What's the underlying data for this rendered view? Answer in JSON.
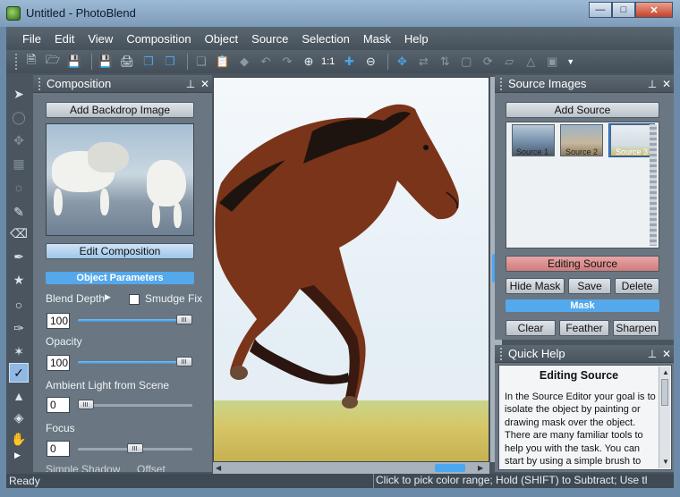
{
  "window": {
    "title": "Untitled - PhotoBlend",
    "minimize": "▭",
    "maximize": "□",
    "close": "✕"
  },
  "menu": [
    "File",
    "Edit",
    "View",
    "Composition",
    "Object",
    "Source",
    "Selection",
    "Mask",
    "Help"
  ],
  "toolbar": {
    "zoom_label": "1:1"
  },
  "composition_panel": {
    "title": "Composition",
    "add_backdrop_label": "Add Backdrop Image",
    "edit_composition_label": "Edit Composition",
    "object_parameters_label": "Object Parameters",
    "blend_depth_label": "Blend Depth",
    "smudge_fix_label": "Smudge Fix",
    "blend_depth_value": "100",
    "opacity_label": "Opacity",
    "opacity_value": "100",
    "ambient_light_label": "Ambient Light from Scene",
    "ambient_light_value": "0",
    "focus_label": "Focus",
    "focus_value": "0",
    "simple_shadow_label": "Simple Shadow",
    "offset_label": "Offset",
    "slider_levels": {
      "blend_depth": 1.0,
      "opacity": 1.0,
      "ambient_light": 0.0,
      "focus": 0.5
    }
  },
  "source_panel": {
    "title": "Source Images",
    "add_source_label": "Add Source",
    "sources": [
      "Source 1",
      "Source 2",
      "Source 3"
    ],
    "selected_source": "Source 3",
    "editing_source_label": "Editing Source",
    "hide_mask_label": "Hide Mask",
    "save_label": "Save",
    "delete_label": "Delete",
    "mask_label": "Mask",
    "clear_label": "Clear",
    "feather_label": "Feather",
    "sharpen_label": "Sharpen"
  },
  "quick_help": {
    "title": "Quick Help",
    "heading": "Editing Source",
    "body": "In the Source Editor your goal is to isolate the object by painting or drawing mask over the object. There are many familiar tools to help you with the task. You can start by using a simple brush to paint the mask or draw a mask"
  },
  "status": {
    "left": "Ready",
    "right": "Click to pick color range; Hold (SHIFT) to Subtract; Use th"
  },
  "colors": {
    "accent": "#54a8ec",
    "editing_source": "#d07c7c",
    "panel_bg": "#6a7681"
  }
}
